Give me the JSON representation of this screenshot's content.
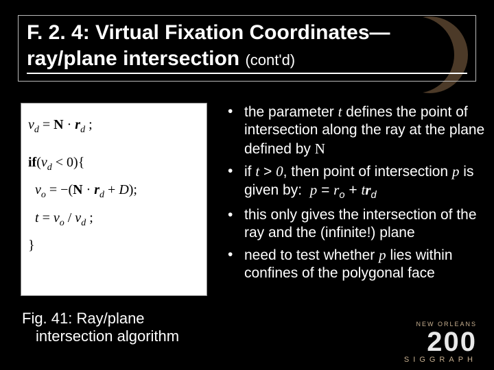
{
  "title": {
    "line1": "F. 2. 4: Virtual Fixation Coordinates—",
    "line2_main": "ray/plane intersection",
    "line2_sub": "(cont'd)"
  },
  "figure": {
    "eq1_html": "<span class='mi'>v</span><sub>d</sub> = <span class='bold'>N</span> · <span class='mi bold'>r</span><sub>d</sub> ;",
    "cond_html": "<span class='bold'>if</span>(<span class='mi'>v</span><sub>d</sub> &lt; 0){",
    "eq2_html": "&nbsp;&nbsp;<span class='mi'>v</span><sub>o</sub> = −(<span class='bold'>N</span> · <span class='mi bold'>r</span><sub>d</sub> + <span class='mi'>D</span>);",
    "eq3_html": "&nbsp;&nbsp;<span class='mi'>t</span> = <span class='mi'>v</span><sub>o</sub> / <span class='mi'>v</span><sub>d</sub> ;",
    "close_html": "}"
  },
  "caption": {
    "line1": "Fig. 41: Ray/plane",
    "line2": "intersection algorithm"
  },
  "bullets": [
    "the parameter <span class='mi'>t</span> defines the point of intersection along the ray at the plane defined by <span class='rm'>N</span>",
    "if <span class='mi'>t</span> &gt; <span class='mi'>0</span>, then point of intersection <span class='mi'>p</span> is given by: &nbsp;<span class='mi'>p</span> = <span class='mi'>r</span><sub>o</sub> + <span class='mi'>t</span><span class='mi bold'>r</span><sub>d</sub>",
    "this only gives the intersection of the ray and the (infinite!) plane",
    "need to test whether <span class='mi'>p</span> lies within confines of the polygonal face"
  ],
  "footer": {
    "org": "SIGGRAPH",
    "year": "200",
    "location": "NEW ORLEANS"
  }
}
